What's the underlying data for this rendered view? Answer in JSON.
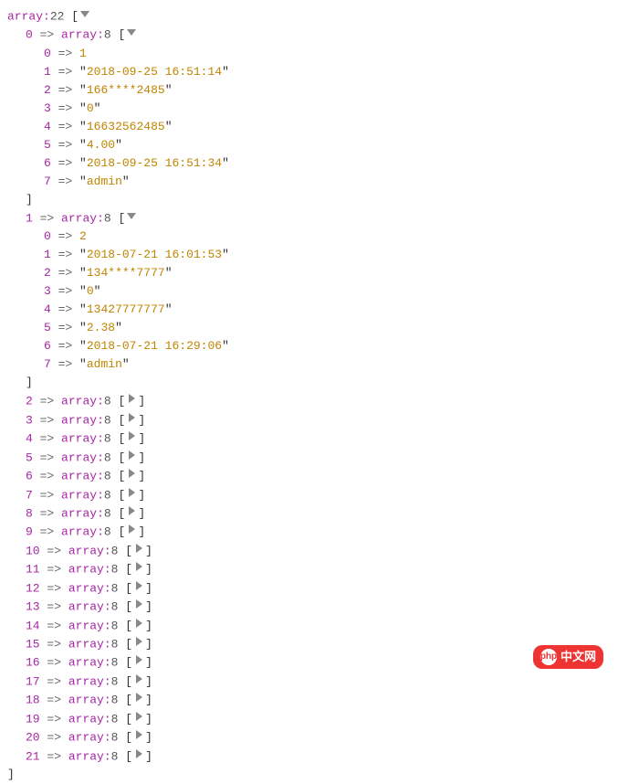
{
  "root": {
    "label": "array",
    "count": "22"
  },
  "expanded": [
    {
      "index": "0",
      "label": "array",
      "count": "8",
      "items": [
        {
          "k": "0",
          "type": "num",
          "v": "1"
        },
        {
          "k": "1",
          "type": "str",
          "v": "2018-09-25 16:51:14"
        },
        {
          "k": "2",
          "type": "str",
          "v": "166****2485"
        },
        {
          "k": "3",
          "type": "str",
          "v": "0"
        },
        {
          "k": "4",
          "type": "str",
          "v": "16632562485"
        },
        {
          "k": "5",
          "type": "str",
          "v": "4.00"
        },
        {
          "k": "6",
          "type": "str",
          "v": "2018-09-25 16:51:34"
        },
        {
          "k": "7",
          "type": "str",
          "v": "admin"
        }
      ]
    },
    {
      "index": "1",
      "label": "array",
      "count": "8",
      "items": [
        {
          "k": "0",
          "type": "num",
          "v": "2"
        },
        {
          "k": "1",
          "type": "str",
          "v": "2018-07-21 16:01:53"
        },
        {
          "k": "2",
          "type": "str",
          "v": "134****7777"
        },
        {
          "k": "3",
          "type": "str",
          "v": "0"
        },
        {
          "k": "4",
          "type": "str",
          "v": "13427777777"
        },
        {
          "k": "5",
          "type": "str",
          "v": "2.38"
        },
        {
          "k": "6",
          "type": "str",
          "v": "2018-07-21 16:29:06"
        },
        {
          "k": "7",
          "type": "str",
          "v": "admin"
        }
      ]
    }
  ],
  "collapsed": [
    {
      "index": "2",
      "label": "array",
      "count": "8"
    },
    {
      "index": "3",
      "label": "array",
      "count": "8"
    },
    {
      "index": "4",
      "label": "array",
      "count": "8"
    },
    {
      "index": "5",
      "label": "array",
      "count": "8"
    },
    {
      "index": "6",
      "label": "array",
      "count": "8"
    },
    {
      "index": "7",
      "label": "array",
      "count": "8"
    },
    {
      "index": "8",
      "label": "array",
      "count": "8"
    },
    {
      "index": "9",
      "label": "array",
      "count": "8"
    },
    {
      "index": "10",
      "label": "array",
      "count": "8"
    },
    {
      "index": "11",
      "label": "array",
      "count": "8"
    },
    {
      "index": "12",
      "label": "array",
      "count": "8"
    },
    {
      "index": "13",
      "label": "array",
      "count": "8"
    },
    {
      "index": "14",
      "label": "array",
      "count": "8"
    },
    {
      "index": "15",
      "label": "array",
      "count": "8"
    },
    {
      "index": "16",
      "label": "array",
      "count": "8"
    },
    {
      "index": "17",
      "label": "array",
      "count": "8"
    },
    {
      "index": "18",
      "label": "array",
      "count": "8"
    },
    {
      "index": "19",
      "label": "array",
      "count": "8"
    },
    {
      "index": "20",
      "label": "array",
      "count": "8"
    },
    {
      "index": "21",
      "label": "array",
      "count": "8"
    }
  ],
  "watermark": {
    "logo": "php",
    "text": "中文网"
  }
}
